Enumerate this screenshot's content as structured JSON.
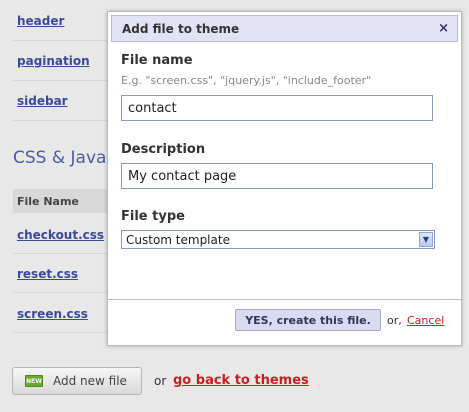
{
  "templates": [
    "header",
    "pagination",
    "sidebar"
  ],
  "section_title": "CSS & Javascript",
  "files_table": {
    "header": "File Name",
    "files": [
      "checkout.css",
      "reset.css",
      "screen.css"
    ]
  },
  "footer": {
    "add_badge": "NEW",
    "add_label": "Add new file",
    "or": "or",
    "back_link": "go back to themes"
  },
  "modal": {
    "title": "Add file to theme",
    "close": "×",
    "file_name_label": "File name",
    "file_name_hint": "E.g. \"screen.css\", \"jquery.js\", \"include_footer\"",
    "file_name_value": "contact",
    "description_label": "Description",
    "description_value": "My contact page",
    "file_type_label": "File type",
    "file_type_value": "Custom template",
    "submit": "YES, create this file.",
    "or": "or,",
    "cancel": "Cancel"
  },
  "colors": {
    "accent": "#4a5aa8",
    "danger": "#c81f1f",
    "modal_header": "#e2e2f5"
  }
}
